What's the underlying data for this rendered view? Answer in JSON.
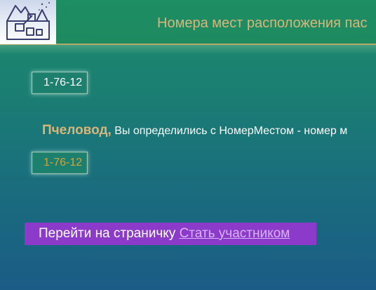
{
  "header": {
    "title": "Номера мест расположения пас",
    "logo_icon": "house-sketch-logo-icon"
  },
  "first_code": {
    "value": "1-76-12"
  },
  "message": {
    "user_name": "Пчеловод,",
    "text": " Вы определились с НомерМестом - номер м"
  },
  "second_code": {
    "value": "1-76-12"
  },
  "cta": {
    "prefix": "Перейти на страничку ",
    "link_text": "Стать участником"
  },
  "colors": {
    "title": "#d8b67a",
    "user_name": "#d8b67a",
    "second_code": "#d1a43a",
    "cta_background": "#8b3ac9",
    "cta_link": "#d9b2ff"
  }
}
